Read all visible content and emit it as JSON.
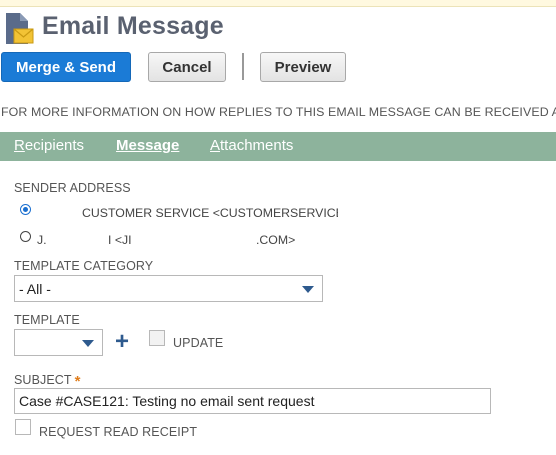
{
  "header": {
    "title": "Email Message",
    "icon": "document-envelope-icon"
  },
  "toolbar": {
    "merge_send_label": "Merge & Send",
    "cancel_label": "Cancel",
    "preview_label": "Preview"
  },
  "info_text": "FOR MORE INFORMATION ON HOW REPLIES TO THIS EMAIL MESSAGE CAN BE RECEIVED AN",
  "tabs": [
    {
      "label_first": "R",
      "label_rest": "ecipients",
      "active": false
    },
    {
      "label_first": "M",
      "label_rest": "essage",
      "active": true
    },
    {
      "label_first": "A",
      "label_rest": "ttachments",
      "active": false
    }
  ],
  "sender": {
    "label": "SENDER ADDRESS",
    "options": [
      {
        "text": "CUSTOMER SERVICE <CUSTOMERSERVICE(",
        "selected": true
      },
      {
        "text_a": "J.",
        "text_b": "I <JI",
        "text_c": ".COM>",
        "selected": false
      }
    ]
  },
  "template_category": {
    "label": "TEMPLATE CATEGORY",
    "value": "- All -"
  },
  "template": {
    "label": "TEMPLATE",
    "value": "",
    "add_icon": "plus-icon",
    "update_label": "UPDATE",
    "update_checked": false
  },
  "subject": {
    "label": "SUBJECT",
    "required_mark": "*",
    "value": "Case #CASE121: Testing no email sent request"
  },
  "read_receipt": {
    "label": "REQUEST READ RECEIPT",
    "checked": false
  },
  "colors": {
    "primary_button": "#1b7bd6",
    "tab_bar": "#8db39c",
    "required": "#e07d1c"
  }
}
